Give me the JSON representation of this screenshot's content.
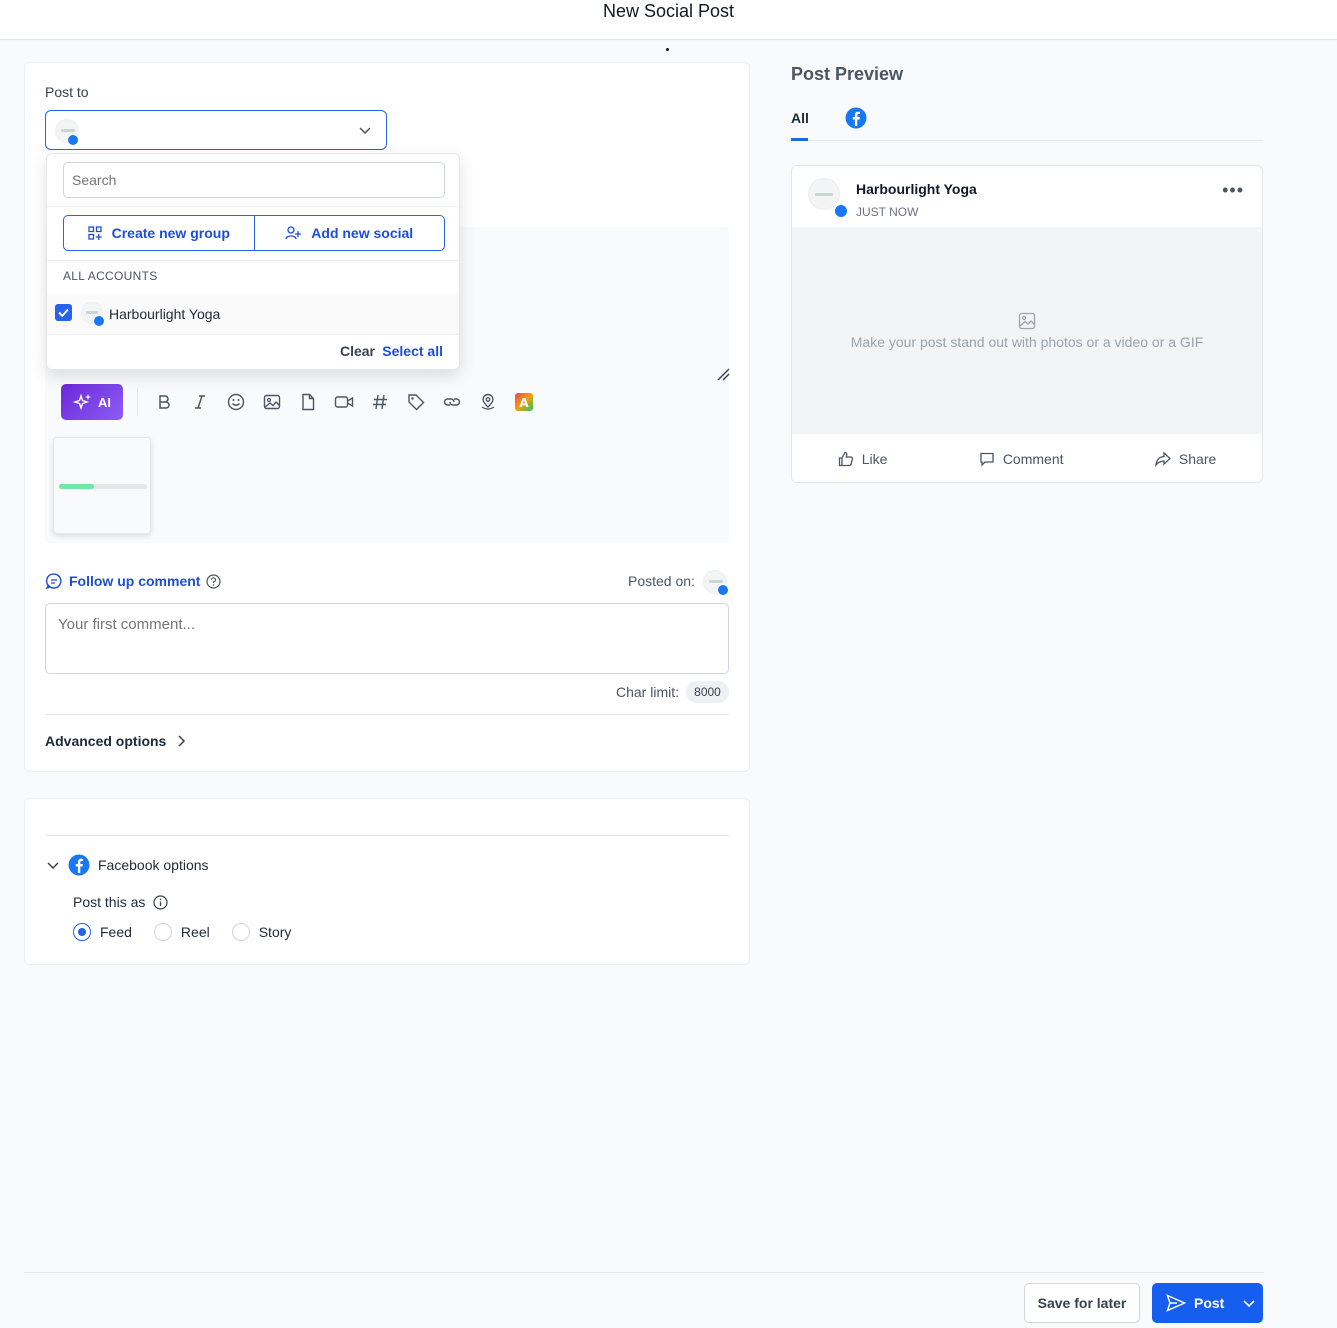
{
  "header": {
    "title": "New Social Post"
  },
  "composer": {
    "post_to_label": "Post to",
    "dropdown": {
      "search_placeholder": "Search",
      "create_group_label": "Create new group",
      "add_social_label": "Add new social",
      "section_label": "ALL ACCOUNTS",
      "accounts": [
        {
          "name": "Harbourlight Yoga",
          "checked": true
        }
      ],
      "clear_label": "Clear",
      "select_all_label": "Select all"
    },
    "toolbar": {
      "ai_label": "AI",
      "icons": [
        "bold-icon",
        "italic-icon",
        "emoji-icon",
        "image-icon",
        "file-icon",
        "video-icon",
        "hashtag-icon",
        "tag-icon",
        "link-icon",
        "location-icon",
        "app-icon"
      ]
    },
    "upload_progress": 0.4,
    "follow_up_label": "Follow up comment",
    "posted_on_label": "Posted on:",
    "comment_placeholder": "Your first comment...",
    "char_limit_label": "Char limit:",
    "char_limit_value": "8000",
    "advanced_label": "Advanced options"
  },
  "facebook_options": {
    "title": "Facebook options",
    "post_as_label": "Post this as",
    "options": [
      "Feed",
      "Reel",
      "Story"
    ],
    "selected": "Feed"
  },
  "preview": {
    "title": "Post Preview",
    "tab_all": "All",
    "account_name": "Harbourlight Yoga",
    "time_label": "JUST NOW",
    "media_placeholder": "Make your post stand out with photos or a video or a GIF",
    "actions": {
      "like": "Like",
      "comment": "Comment",
      "share": "Share"
    }
  },
  "footer": {
    "save_label": "Save for later",
    "post_label": "Post"
  },
  "colors": {
    "accent": "#2563eb",
    "facebook": "#1877f2",
    "ai_gradient": "#7c3aed",
    "progress": "#6ee7a7"
  }
}
